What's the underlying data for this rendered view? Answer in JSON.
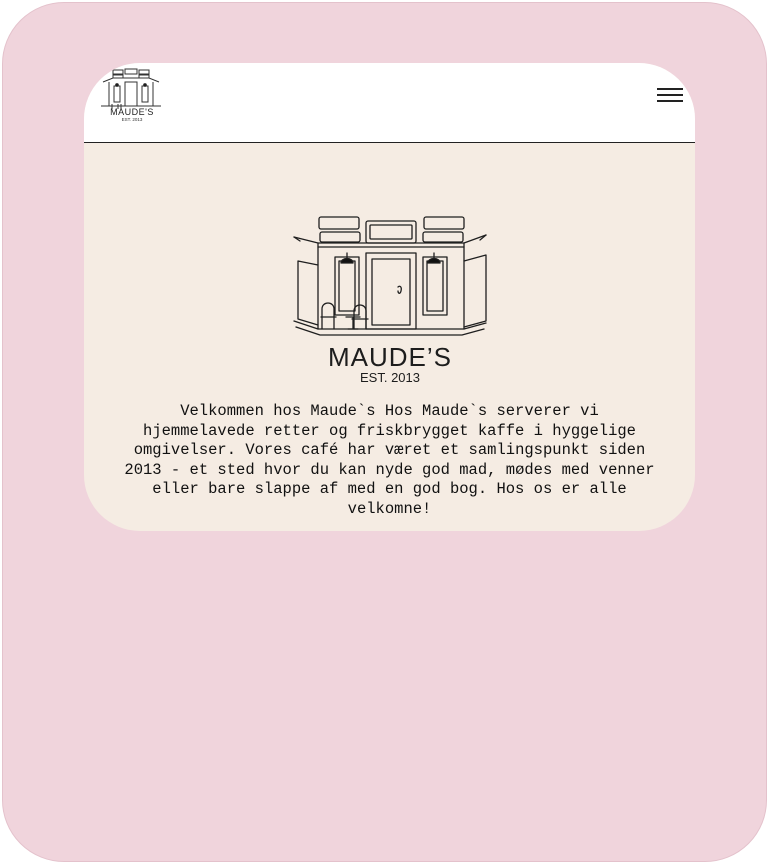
{
  "header": {
    "logo_icon": "storefront-sketch-icon",
    "logo_name": "MAUDE'S",
    "logo_est": "EST. 2013",
    "menu_icon": "hamburger-menu-icon"
  },
  "hero": {
    "illustration_icon": "storefront-sketch-icon",
    "name": "MAUDE’S",
    "est": "EST. 2013",
    "welcome_text": "Velkommen hos Maude`s Hos Maude`s serverer vi hjemmelavede retter og friskbrygget kaffe i hyggelige omgivelser. Vores café har været et samlingspunkt siden 2013 - et sted hvor du kan nyde god mad, mødes med venner eller bare slappe af med en god bog. Hos os er alle velkomne!"
  },
  "colors": {
    "device_frame": "#f0d4dc",
    "page_background": "#f5ece3",
    "header_background": "#ffffff",
    "text": "#111111"
  }
}
